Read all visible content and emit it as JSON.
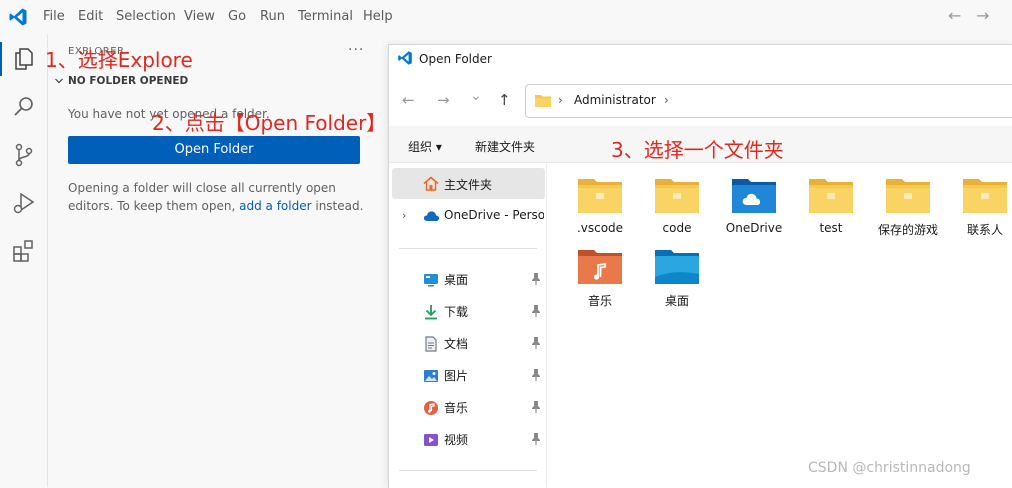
{
  "menu": [
    "File",
    "Edit",
    "Selection",
    "View",
    "Go",
    "Run",
    "Terminal",
    "Help"
  ],
  "nav": {
    "back": "←",
    "forward": "→"
  },
  "explorer": {
    "title": "EXPLORER",
    "more": "···",
    "section_title": "NO FOLDER OPENED",
    "message": "You have not yet opened a folder.",
    "open_button": "Open Folder",
    "info_before": "Opening a folder will close all currently open editors. To keep them open, ",
    "info_link": "add a folder",
    "info_after": " instead."
  },
  "annotations": {
    "step1": "1、选择Explore",
    "step2": "2、点击【Open Folder】",
    "step3": "3、选择一个文件夹"
  },
  "dialog": {
    "title": "Open Folder",
    "nav_back": "←",
    "nav_forward": "→",
    "nav_recent": "⌄",
    "nav_up": "↑",
    "address_separator": "›",
    "address_path": "Administrator",
    "toolbar": {
      "organize": "组织 ▾",
      "new_folder": "新建文件夹"
    },
    "navigation": {
      "home": "主文件夹",
      "onedrive": "OneDrive - Perso",
      "quick_access": [
        {
          "label": "桌面",
          "icon": "desktop-icon",
          "color": "#1f8fd6"
        },
        {
          "label": "下载",
          "icon": "download-icon",
          "color": "#1f9a5a"
        },
        {
          "label": "文档",
          "icon": "document-icon",
          "color": "#6b7a8c"
        },
        {
          "label": "图片",
          "icon": "picture-icon",
          "color": "#2f7fd0"
        },
        {
          "label": "音乐",
          "icon": "music-icon",
          "color": "#e06040"
        },
        {
          "label": "视频",
          "icon": "video-icon",
          "color": "#8a4fd0"
        }
      ]
    },
    "folders": [
      {
        "label": ".vscode",
        "kind": "plain"
      },
      {
        "label": "code",
        "kind": "plain"
      },
      {
        "label": "OneDrive",
        "kind": "onedrive"
      },
      {
        "label": "test",
        "kind": "plain"
      },
      {
        "label": "保存的游戏",
        "kind": "plain"
      },
      {
        "label": "联系人",
        "kind": "plain"
      },
      {
        "label": "音乐",
        "kind": "music"
      },
      {
        "label": "桌面",
        "kind": "desktop"
      }
    ]
  },
  "watermark": "CSDN @christinnadong",
  "colors": {
    "accent": "#005fb8",
    "annotation": "#e0281e",
    "folder": "#f6c84c"
  }
}
